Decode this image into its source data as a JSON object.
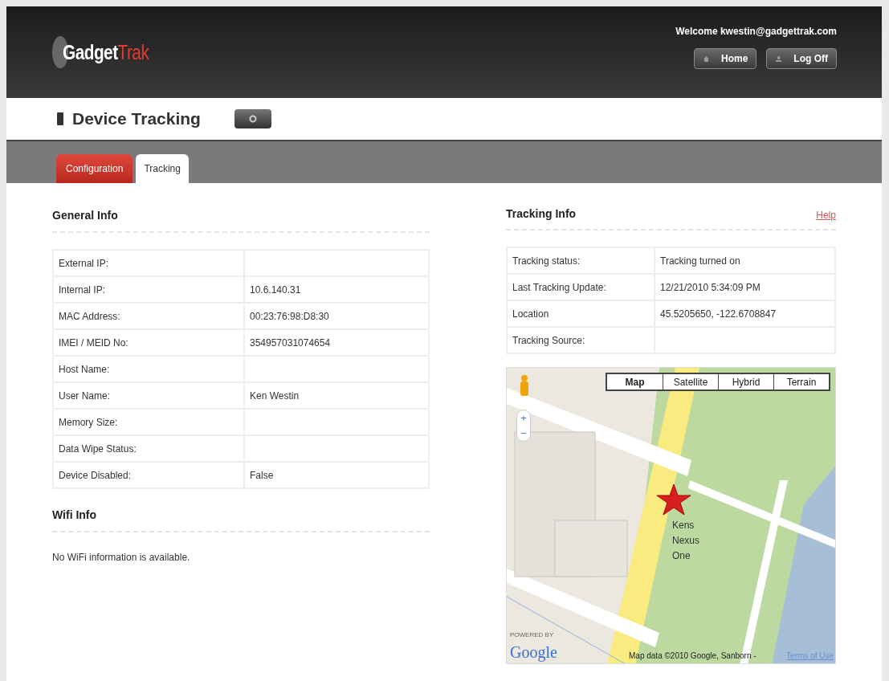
{
  "header": {
    "logo": {
      "text": "Gadget",
      "accent": "Trak"
    },
    "welcome": "Welcome kwestin@gadgettrak.com",
    "buttons": [
      {
        "label": "Home",
        "kind": "home"
      },
      {
        "label": "Log Off",
        "kind": "user"
      }
    ]
  },
  "page_title": "Device Tracking",
  "tabs": [
    {
      "label": "Configuration",
      "selected": false
    },
    {
      "label": "Tracking",
      "selected": true
    }
  ],
  "general_info": {
    "title": "General Info",
    "rows": [
      {
        "label": "External IP:",
        "value": ""
      },
      {
        "label": "Internal IP:",
        "value": "10.6.140.31"
      },
      {
        "label": "MAC Address:",
        "value": "00:23:76:98:D8:30"
      },
      {
        "label": "IMEI / MEID No:",
        "value": "354957031074654"
      },
      {
        "label": "Host Name:",
        "value": ""
      },
      {
        "label": "User Name:",
        "value": "Ken Westin"
      },
      {
        "label": "Memory Size:",
        "value": ""
      },
      {
        "label": "Data Wipe Status:",
        "value": ""
      },
      {
        "label": "Device Disabled:",
        "value": "False"
      }
    ]
  },
  "wifi_info": {
    "title": "Wifi Info",
    "message": "No WiFi information is available."
  },
  "tracking_info": {
    "title": "Tracking Info",
    "help_link": "Help",
    "rows": [
      {
        "label": "Tracking status:",
        "value": "Tracking turned on"
      },
      {
        "label": "Last Tracking Update:",
        "value": "12/21/2010 5:34:09 PM"
      },
      {
        "label": "Location",
        "value": "45.5205650, -122.6708847"
      },
      {
        "label": "Tracking Source:",
        "value": ""
      }
    ]
  },
  "map": {
    "map_types": [
      {
        "label": "Map",
        "selected": true
      },
      {
        "label": "Satellite",
        "selected": false
      },
      {
        "label": "Hybrid",
        "selected": false
      },
      {
        "label": "Terrain",
        "selected": false
      }
    ],
    "zoom_in": "+",
    "zoom_out": "−",
    "marker_label": "Kens Nexus One",
    "powered_by": "POWERED BY",
    "google": "Google",
    "attribution": "Map data ©2010 Google, Sanborn -",
    "terms_link": "Terms of Use"
  }
}
